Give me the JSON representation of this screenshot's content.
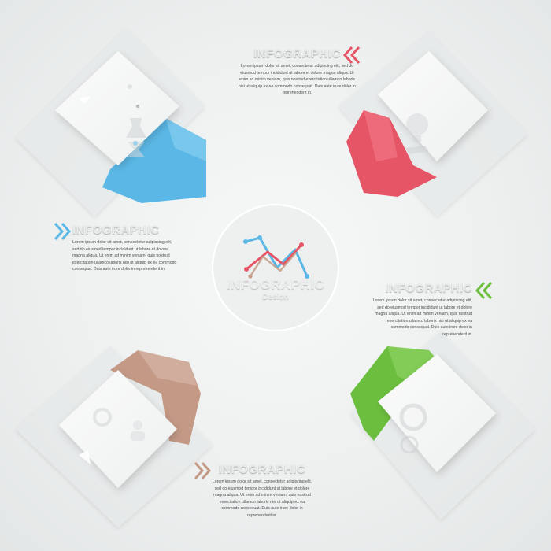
{
  "center": {
    "title": "INFOGRAPHIC",
    "subtitle": "Design",
    "chart_icon_colors": [
      "#5bb8e6",
      "#e65565",
      "#c49a86"
    ]
  },
  "steps": [
    {
      "id": "top",
      "color": "#e65565",
      "icon": "hand-holding-lightbulb-icon",
      "heading": "INFOGRAPHIC",
      "body": "Lorem ipsum dolor sit amet, consectetur adipiscing elit, sed do eiusmod tempor incididunt ut labore et dolore magna aliqua. Ut enim ad minim veniam, quis nostrud exercitation ullamco laboris nisi ut aliquip ex ea commodo consequat. Duis aute irure dolor in reprehenderit in."
    },
    {
      "id": "right",
      "color": "#6cbf3e",
      "icon": "gear-settings-icon",
      "heading": "INFOGRAPHIC",
      "body": "Lorem ipsum dolor sit amet, consectetur adipiscing elit, sed do eiusmod tempor incididunt ut labore et dolore magna aliqua. Ut enim ad minim veniam, quis nostrud exercitation ullamco laboris nisi ut aliquip ex ea commodo consequat. Duis aute irure dolor in reprehenderit in."
    },
    {
      "id": "bottom",
      "color": "#c49a86",
      "icon": "magnifier-people-icon",
      "heading": "INFOGRAPHIC",
      "body": "Lorem ipsum dolor sit amet, consectetur adipiscing elit, sed do eiusmod tempor incididunt ut labore et dolore magna aliqua. Ut enim ad minim veniam, quis nostrud exercitation ullamco laboris nisi ut aliquip ex ea commodo consequat. Duis aute irure dolor in reprehenderit in."
    },
    {
      "id": "left",
      "color": "#5bb8e6",
      "icon": "flask-hourglass-icon",
      "heading": "INFOGRAPHIC",
      "body": "Lorem ipsum dolor sit amet, consectetur adipiscing elit, sed do eiusmod tempor incididunt ut labore et dolore magna aliqua. Ut enim ad minim veniam, quis nostrud exercitation ullamco laboris nisi ut aliquip ex ea commodo consequat. Duis aute irure dolor in reprehenderit in."
    }
  ]
}
